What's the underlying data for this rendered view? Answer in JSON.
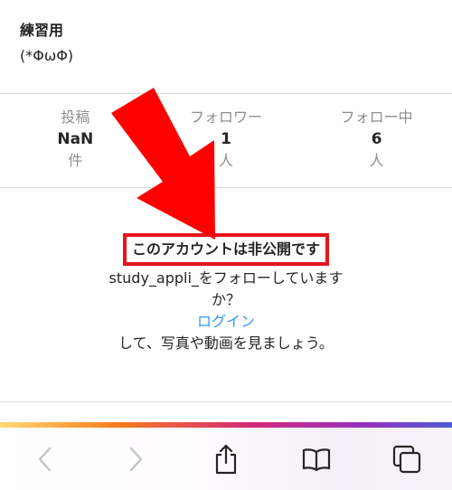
{
  "profile": {
    "name": "練習用",
    "bio": "(*ΦωΦ)"
  },
  "stats": [
    {
      "label": "投稿",
      "value": "NaN",
      "unit": "件"
    },
    {
      "label": "フォロワー",
      "value": "1",
      "unit": "人"
    },
    {
      "label": "フォロー中",
      "value": "6",
      "unit": "人"
    }
  ],
  "private": {
    "title": "このアカウントは非公開です",
    "line1": "study_appli_をフォローしていま",
    "line1b": "す",
    "line2": "か？",
    "login": "ログイン",
    "line3": "して、写真や動画を見ましょう。"
  },
  "colors": {
    "highlight": "#e8141b",
    "link": "#3897f0"
  },
  "toolbar": {
    "icons": [
      "back-icon",
      "forward-icon",
      "share-icon",
      "bookmarks-icon",
      "tabs-icon"
    ]
  }
}
